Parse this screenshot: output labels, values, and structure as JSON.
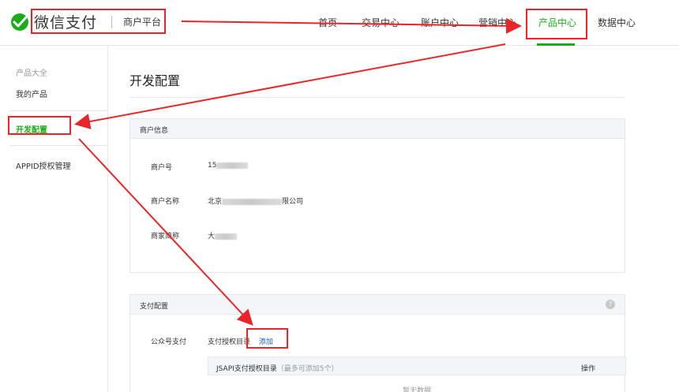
{
  "header": {
    "brand": "微信支付",
    "sub_brand": "商户平台",
    "nav": [
      {
        "label": "首页"
      },
      {
        "label": "交易中心"
      },
      {
        "label": "账户中心"
      },
      {
        "label": "营销中心"
      },
      {
        "label": "产品中心"
      },
      {
        "label": "数据中心"
      }
    ],
    "active_nav": "产品中心"
  },
  "sidebar": {
    "category": "产品大全",
    "items": [
      {
        "label": "我的产品"
      },
      {
        "label": "开发配置"
      },
      {
        "label": "APPID授权管理"
      }
    ],
    "active_item": "开发配置"
  },
  "main": {
    "title": "开发配置",
    "merchant_panel": {
      "heading": "商户信息",
      "rows": [
        {
          "label": "商户号",
          "value": "15"
        },
        {
          "label": "商户名称",
          "value_prefix": "北京",
          "value_suffix": "限公司"
        },
        {
          "label": "商家简称",
          "value": "大"
        }
      ]
    },
    "pay_panel": {
      "heading": "支付配置",
      "help_icon": "?",
      "row_label": "公众号支付",
      "row_value": "支付授权目录",
      "add_link": "添加",
      "table": {
        "head_main": "JSAPI支付授权目录",
        "head_hint": "（最多可添加5个）",
        "head_op": "操作",
        "empty": "暂无数据"
      }
    }
  },
  "colors": {
    "accent_green": "#1aad19",
    "annotation_red": "#e8262a",
    "link_blue": "#1a57c4"
  }
}
